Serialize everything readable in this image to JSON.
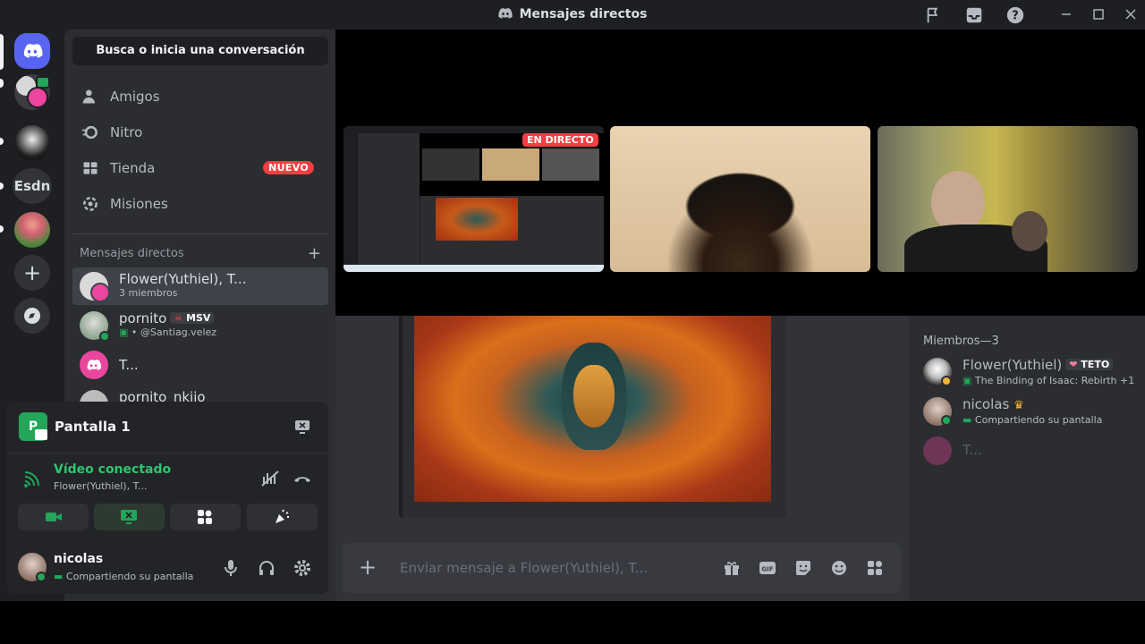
{
  "window": {
    "title": "Mensajes directos"
  },
  "rail": {
    "server_text": "Esdn"
  },
  "panel": {
    "search_label": "Busca o inicia una conversación",
    "nav": [
      {
        "label": "Amigos"
      },
      {
        "label": "Nitro"
      },
      {
        "label": "Tienda",
        "badge": "NUEVO"
      },
      {
        "label": "Misiones"
      }
    ],
    "dm_header": "Mensajes directos",
    "dms": [
      {
        "name": "Flower(Yuthiel), T...",
        "sub": "3 miembros"
      },
      {
        "name": "pornito",
        "tag": "MSV",
        "sub": "@Santiag.velez"
      },
      {
        "name": "T..."
      },
      {
        "name": "pornito_nkjio"
      }
    ]
  },
  "voice": {
    "stream_title": "Pantalla 1",
    "status": "Vídeo conectado",
    "channel": "Flower(Yuthiel), T...",
    "user": {
      "name": "nicolas",
      "status": "Compartiendo su pantalla"
    }
  },
  "stage": {
    "live_badge": "EN DIRECTO"
  },
  "composer": {
    "placeholder": "Enviar mensaje a Flower(Yuthiel), T..."
  },
  "members": {
    "header": "Miembros—3",
    "list": [
      {
        "name": "Flower(Yuthiel)",
        "tag": "TETO",
        "sub": "The Binding of Isaac: Rebirth +1"
      },
      {
        "name": "nicolas",
        "sub": "Compartiendo su pantalla"
      },
      {
        "name": "T..."
      }
    ]
  },
  "colors": {
    "accent": "#5865f2",
    "green": "#23a55a",
    "red": "#f23f43",
    "voice_green": "#2dc770"
  }
}
